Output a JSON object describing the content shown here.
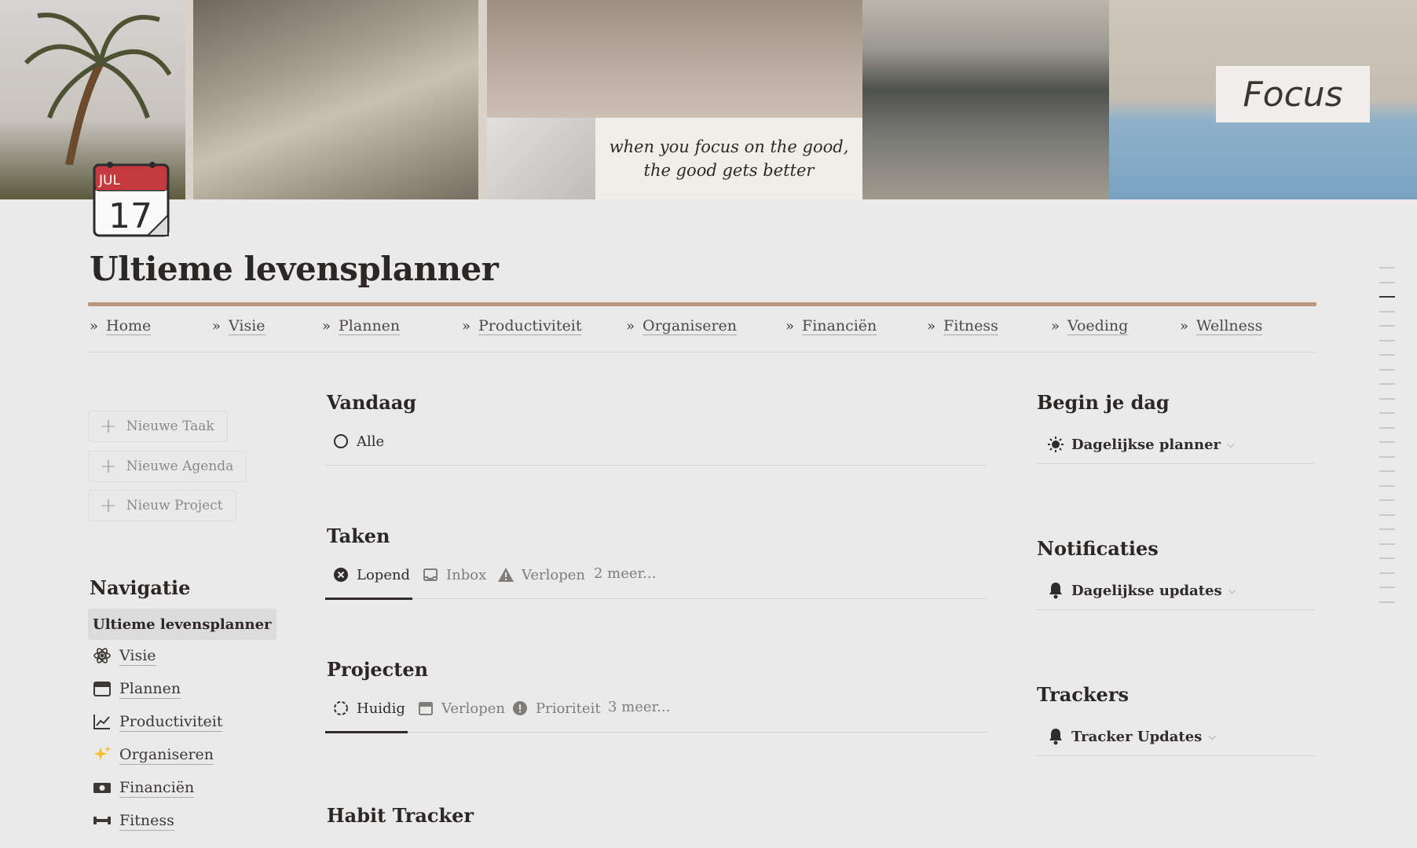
{
  "cover": {
    "quote": "when you focus on the good, the good gets better",
    "quote_line1": "when you focus on the good,",
    "quote_line2": "the good gets better",
    "focus_label": "Focus"
  },
  "calendar_icon": {
    "month": "JUL",
    "day": "17"
  },
  "page": {
    "title": "Ultieme levensplanner"
  },
  "top_nav": [
    {
      "label": "Home"
    },
    {
      "label": "Visie"
    },
    {
      "label": "Plannen"
    },
    {
      "label": "Productiviteit"
    },
    {
      "label": "Organiseren"
    },
    {
      "label": "Financiën"
    },
    {
      "label": "Fitness"
    },
    {
      "label": "Voeding"
    },
    {
      "label": "Wellness"
    }
  ],
  "quick_actions": [
    {
      "label": "Nieuwe Taak"
    },
    {
      "label": "Nieuwe Agenda"
    },
    {
      "label": "Nieuw Project"
    }
  ],
  "navigation": {
    "heading": "Navigatie",
    "current": "Ultieme levensplanner",
    "items": [
      {
        "label": "Visie",
        "icon": "atom-icon"
      },
      {
        "label": "Plannen",
        "icon": "calendar-icon"
      },
      {
        "label": "Productiviteit",
        "icon": "chart-line-icon"
      },
      {
        "label": "Organiseren",
        "icon": "sparkles-icon"
      },
      {
        "label": "Financiën",
        "icon": "money-icon"
      },
      {
        "label": "Fitness",
        "icon": "dumbbell-icon"
      }
    ]
  },
  "vandaag": {
    "heading": "Vandaag",
    "tabs": [
      {
        "label": "Alle",
        "icon": "circle-icon"
      }
    ]
  },
  "taken": {
    "heading": "Taken",
    "tabs": [
      {
        "label": "Lopend",
        "icon": "x-circle-icon"
      },
      {
        "label": "Inbox",
        "icon": "inbox-icon"
      },
      {
        "label": "Verlopen",
        "icon": "warning-icon"
      }
    ],
    "more": "2 meer..."
  },
  "projecten": {
    "heading": "Projecten",
    "tabs": [
      {
        "label": "Huidig",
        "icon": "dashed-circle-icon"
      },
      {
        "label": "Verlopen",
        "icon": "calendar-icon"
      },
      {
        "label": "Prioriteit",
        "icon": "exclamation-circle-icon"
      }
    ],
    "more": "3 meer..."
  },
  "habit_tracker": {
    "heading": "Habit Tracker"
  },
  "right": {
    "begin": {
      "heading": "Begin je dag",
      "selector": "Dagelijkse planner",
      "icon": "sun-icon"
    },
    "notificaties": {
      "heading": "Notificaties",
      "selector": "Dagelijkse updates",
      "icon": "bell-icon"
    },
    "trackers": {
      "heading": "Trackers",
      "selector": "Tracker Updates",
      "icon": "bell-icon"
    }
  },
  "colors": {
    "accent_rule": "#b9957d",
    "background": "#eaeaea",
    "calendar_red": "#c43a3f"
  }
}
